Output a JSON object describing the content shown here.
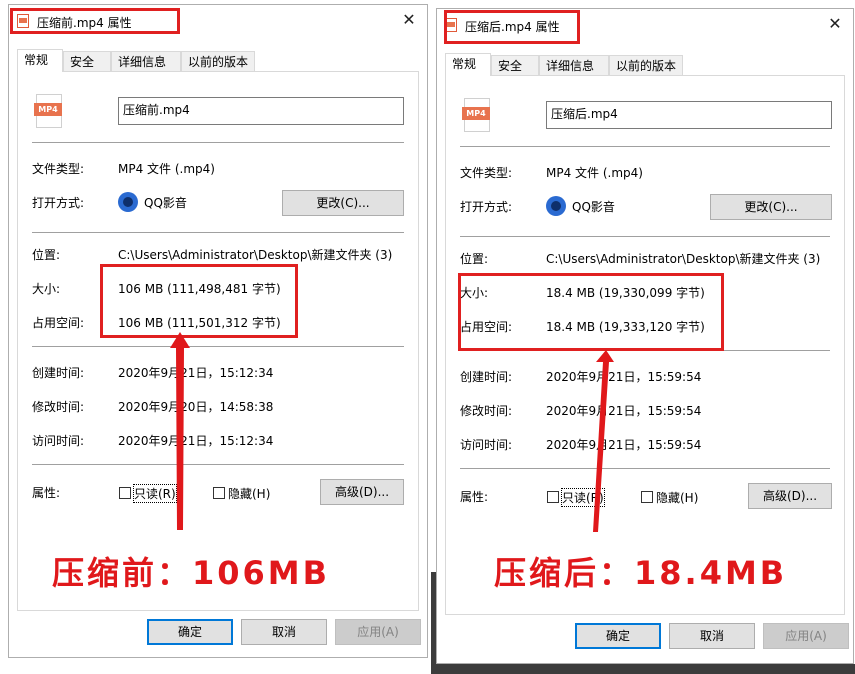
{
  "windows": [
    {
      "title": "压缩前.mp4 属性",
      "tabs": [
        "常规",
        "安全",
        "详细信息",
        "以前的版本"
      ],
      "icon_label": "MP4",
      "filename": "压缩前.mp4",
      "file_type_label": "文件类型:",
      "file_type_value": "MP4 文件 (.mp4)",
      "open_with_label": "打开方式:",
      "open_with_value": "QQ影音",
      "change_button": "更改(C)...",
      "location_label": "位置:",
      "location_value": "C:\\Users\\Administrator\\Desktop\\新建文件夹 (3)",
      "size_label": "大小:",
      "size_value": "106 MB (111,498,481 字节)",
      "disk_label": "占用空间:",
      "disk_value": "106 MB (111,501,312 字节)",
      "created_label": "创建时间:",
      "created_value": "2020年9月21日，15:12:34",
      "modified_label": "修改时间:",
      "modified_value": "2020年9月20日，14:58:38",
      "accessed_label": "访问时间:",
      "accessed_value": "2020年9月21日，15:12:34",
      "attributes_label": "属性:",
      "readonly_label": "只读(R)",
      "hidden_label": "隐藏(H)",
      "advanced_button": "高级(D)...",
      "ok_button": "确定",
      "cancel_button": "取消",
      "apply_button": "应用(A)",
      "caption": "压缩前：106MB"
    },
    {
      "title": "压缩后.mp4 属性",
      "tabs": [
        "常规",
        "安全",
        "详细信息",
        "以前的版本"
      ],
      "icon_label": "MP4",
      "filename": "压缩后.mp4",
      "file_type_label": "文件类型:",
      "file_type_value": "MP4 文件 (.mp4)",
      "open_with_label": "打开方式:",
      "open_with_value": "QQ影音",
      "change_button": "更改(C)...",
      "location_label": "位置:",
      "location_value": "C:\\Users\\Administrator\\Desktop\\新建文件夹 (3)",
      "size_label": "大小:",
      "size_value": "18.4 MB (19,330,099 字节)",
      "disk_label": "占用空间:",
      "disk_value": "18.4 MB (19,333,120 字节)",
      "created_label": "创建时间:",
      "created_value": "2020年9月21日，15:59:54",
      "modified_label": "修改时间:",
      "modified_value": "2020年9月21日，15:59:54",
      "accessed_label": "访问时间:",
      "accessed_value": "2020年9月21日，15:59:54",
      "attributes_label": "属性:",
      "readonly_label": "只读(R)",
      "hidden_label": "隐藏(H)",
      "advanced_button": "高级(D)...",
      "ok_button": "确定",
      "cancel_button": "取消",
      "apply_button": "应用(A)",
      "caption": "压缩后：18.4MB"
    }
  ],
  "colors": {
    "highlight_red": "#e02020",
    "caption_red": "#e0181b",
    "focus_blue": "#0078d7",
    "mp4_orange": "#e8734e"
  }
}
